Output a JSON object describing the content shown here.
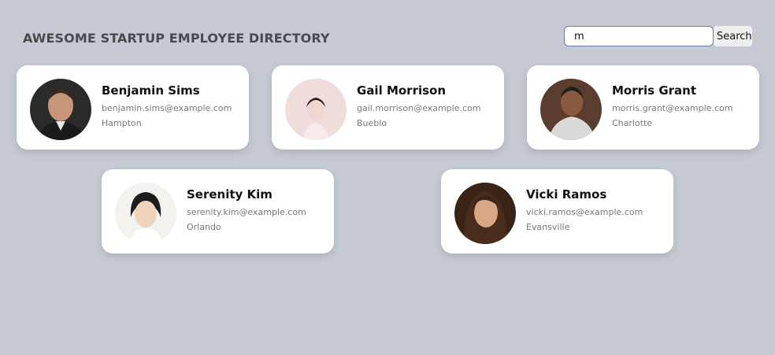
{
  "header": {
    "title": "AWESOME STARTUP EMPLOYEE DIRECTORY"
  },
  "search": {
    "value": "m",
    "button_label": "Search"
  },
  "employees": [
    {
      "name": "Benjamin Sims",
      "email": "benjamin.sims@example.com",
      "city": "Hampton"
    },
    {
      "name": "Gail Morrison",
      "email": "gail.morrison@example.com",
      "city": "Bueblo"
    },
    {
      "name": "Morris Grant",
      "email": "morris.grant@example.com",
      "city": "Charlotte"
    },
    {
      "name": "Serenity Kim",
      "email": "serenity.kim@example.com",
      "city": "Orlando"
    },
    {
      "name": "Vicki Ramos",
      "email": "vicki.ramos@example.com",
      "city": "Evansville"
    }
  ],
  "colors": {
    "background": "#c5cad3",
    "card": "#ffffff",
    "title_text": "#4a4a4a",
    "secondary_text": "#777777",
    "input_border": "#7a7aa8"
  }
}
